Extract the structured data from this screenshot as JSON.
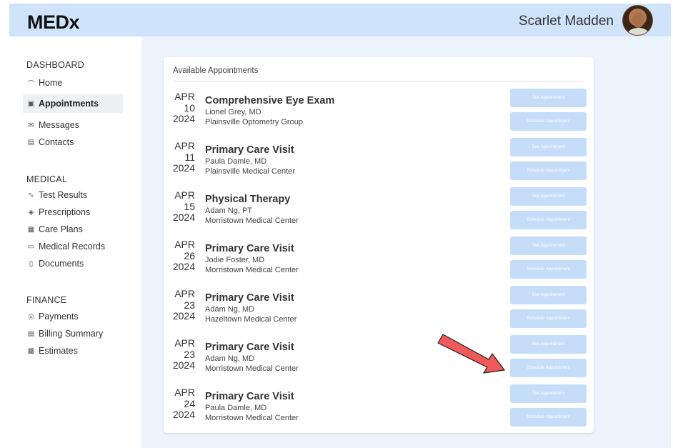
{
  "header": {
    "logo": "MEDx",
    "user_name": "Scarlet Madden"
  },
  "sidebar": {
    "sections": [
      {
        "title": "DASHBOARD",
        "items": [
          {
            "label": "Home",
            "icon": "home-icon",
            "active": false
          },
          {
            "label": "Appointments",
            "icon": "calendar-icon",
            "active": true
          },
          {
            "label": "Messages",
            "icon": "mail-icon",
            "active": false
          },
          {
            "label": "Contacts",
            "icon": "contact-card-icon",
            "active": false
          }
        ]
      },
      {
        "title": "MEDICAL",
        "items": [
          {
            "label": "Test Results",
            "icon": "pulse-icon",
            "active": false
          },
          {
            "label": "Prescriptions",
            "icon": "pill-icon",
            "active": false
          },
          {
            "label": "Care Plans",
            "icon": "building-icon",
            "active": false
          },
          {
            "label": "Medical Records",
            "icon": "folder-icon",
            "active": false
          },
          {
            "label": "Documents",
            "icon": "document-icon",
            "active": false
          }
        ]
      },
      {
        "title": "FINANCE",
        "items": [
          {
            "label": "Payments",
            "icon": "dollar-icon",
            "active": false
          },
          {
            "label": "Billing Summary",
            "icon": "billing-icon",
            "active": false
          },
          {
            "label": "Estimates",
            "icon": "calculator-icon",
            "active": false
          }
        ]
      }
    ]
  },
  "main": {
    "card_title": "Available Appointments",
    "see_label": "See Appointment",
    "schedule_label": "Schedule Appointment",
    "appointments": [
      {
        "month": "APR",
        "day": "10",
        "year": "2024",
        "title": "Comprehensive Eye Exam",
        "doctor": "Lionel Grey, MD",
        "location": "Plainsville Optometry Group"
      },
      {
        "month": "APR",
        "day": "11",
        "year": "2024",
        "title": "Primary Care Visit",
        "doctor": "Paula Damle, MD",
        "location": "Plainsville Medical Center"
      },
      {
        "month": "APR",
        "day": "15",
        "year": "2024",
        "title": "Physical Therapy",
        "doctor": "Adam Ng, PT",
        "location": "Morristown Medical Center"
      },
      {
        "month": "APR",
        "day": "26",
        "year": "2024",
        "title": "Primary Care Visit",
        "doctor": "Jodie Foster, MD",
        "location": "Morristown Medical Center"
      },
      {
        "month": "APR",
        "day": "23",
        "year": "2024",
        "title": "Primary Care Visit",
        "doctor": "Adam Ng, MD",
        "location": "Hazeltown Medical Center"
      },
      {
        "month": "APR",
        "day": "23",
        "year": "2024",
        "title": "Primary Care Visit",
        "doctor": "Adam Ng, MD",
        "location": "Morristown Medical Center"
      },
      {
        "month": "APR",
        "day": "24",
        "year": "2024",
        "title": "Primary Care Visit",
        "doctor": "Paula Damle, MD",
        "location": "Morristown Medical Center"
      }
    ]
  },
  "colors": {
    "header_bg": "#cfe3fb",
    "main_bg": "#eef4fd",
    "button_bg": "#c6ddf9",
    "arrow": "#f05a5a"
  }
}
